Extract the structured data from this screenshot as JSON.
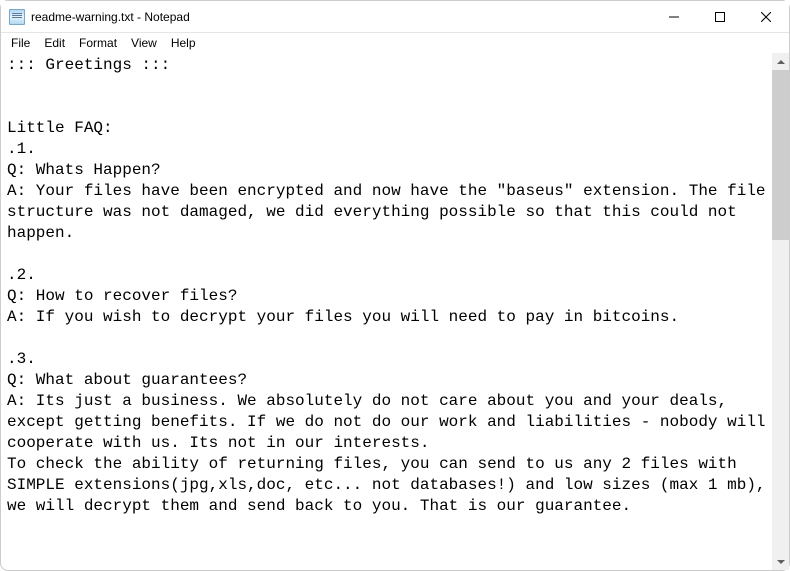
{
  "window": {
    "title": "readme-warning.txt - Notepad"
  },
  "menu": {
    "file": "File",
    "edit": "Edit",
    "format": "Format",
    "view": "View",
    "help": "Help"
  },
  "document": {
    "content": "::: Greetings :::\n\n\nLittle FAQ:\n.1.\nQ: Whats Happen?\nA: Your files have been encrypted and now have the \"baseus\" extension. The file structure was not damaged, we did everything possible so that this could not happen.\n\n.2.\nQ: How to recover files?\nA: If you wish to decrypt your files you will need to pay in bitcoins.\n\n.3.\nQ: What about guarantees?\nA: Its just a business. We absolutely do not care about you and your deals, except getting benefits. If we do not do our work and liabilities - nobody will cooperate with us. Its not in our interests.\nTo check the ability of returning files, you can send to us any 2 files with SIMPLE extensions(jpg,xls,doc, etc... not databases!) and low sizes (max 1 mb), we will decrypt them and send back to you. That is our guarantee."
  }
}
